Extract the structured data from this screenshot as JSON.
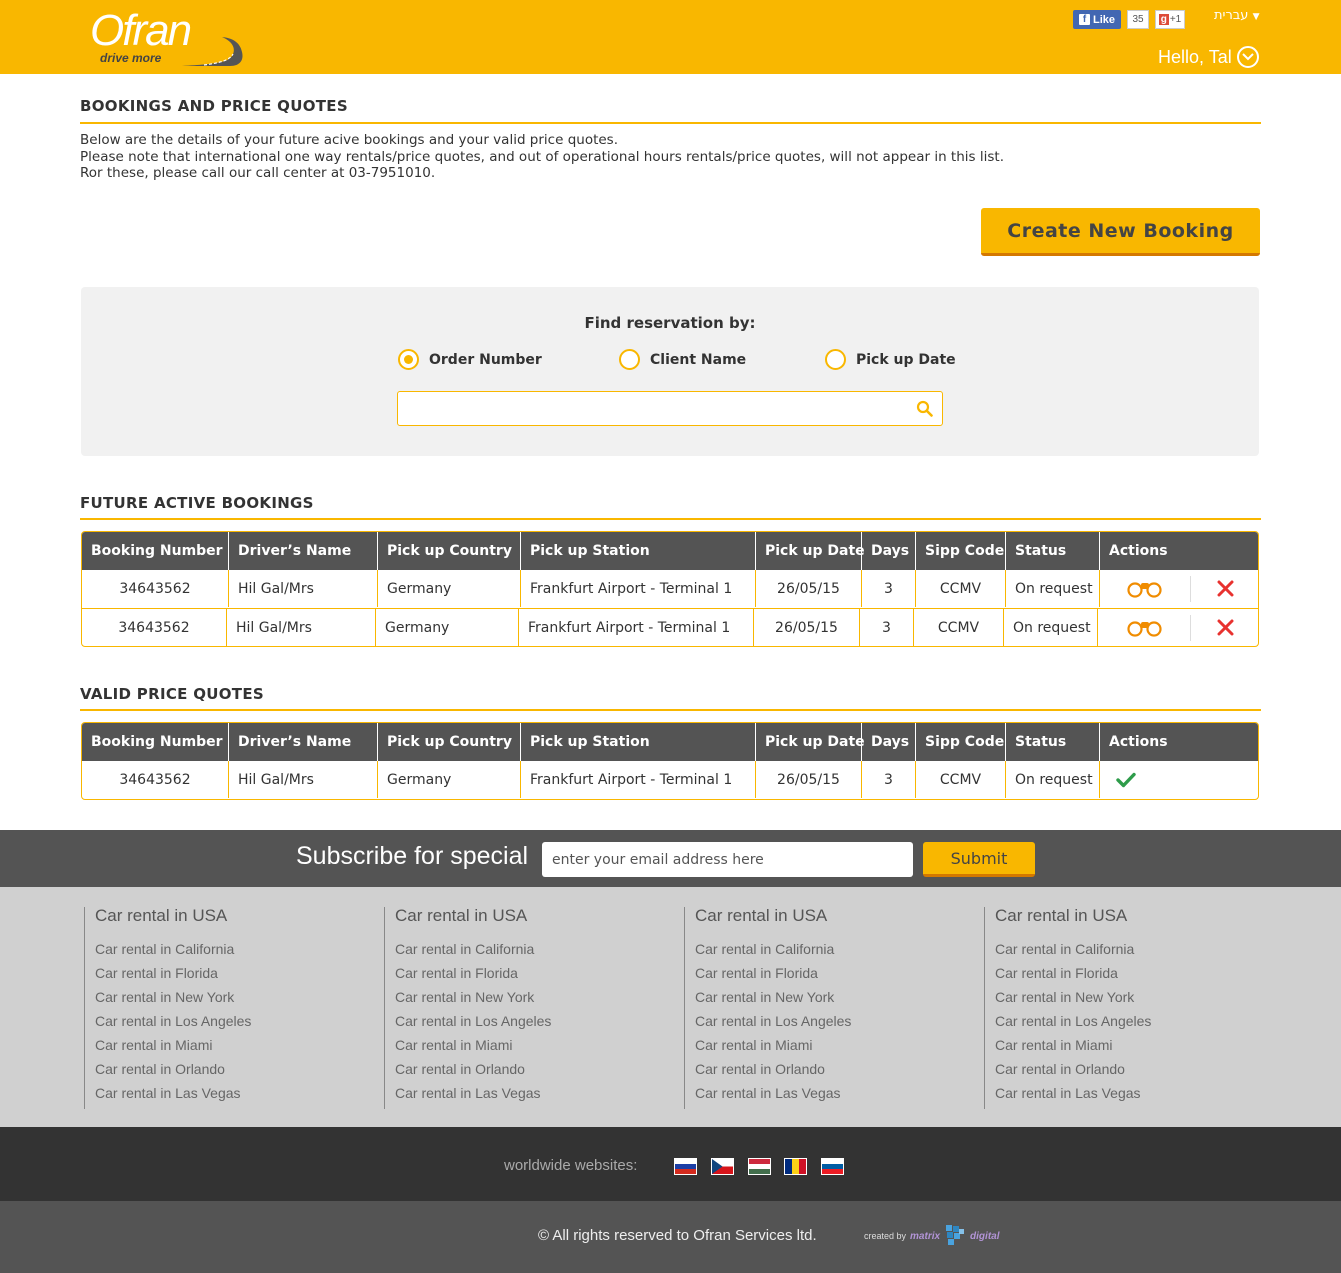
{
  "header": {
    "logo_text": "Ofran",
    "logo_tagline": "drive more",
    "fb_like": "Like",
    "fb_count": "35",
    "gplus_label": "+1",
    "language": "עברית",
    "greeting": "Hello, Tal",
    "brand_color": "#f9b700"
  },
  "intro": {
    "title": "BOOKINGS AND PRICE QUOTES",
    "lines": [
      "Below are the details of your future acive bookings and your valid price quotes.",
      "Please note that international one way rentals/price quotes, and out of operational hours rentals/price quotes, will not appear in this list.",
      "Ror these, please call our call center at 03-7951010."
    ],
    "create_button": "Create New Booking"
  },
  "find": {
    "label": "Find reservation by:",
    "options": [
      "Order Number",
      "Client Name",
      "Pick up Date"
    ],
    "selected": "Order Number",
    "search_value": ""
  },
  "columns": [
    "Booking Number",
    "Driver’s Name",
    "Pick up Country",
    "Pick up Station",
    "Pick up Date",
    "Days",
    "Sipp Code",
    "Status",
    "Actions"
  ],
  "future_bookings": {
    "title": "FUTURE ACTIVE BOOKINGS",
    "rows": [
      {
        "booking": "34643562",
        "driver": "Hil Gal/Mrs",
        "country": "Germany",
        "station": "Frankfurt Airport - Terminal 1",
        "date": "26/05/15",
        "days": "3",
        "sipp": "CCMV",
        "status": "On request",
        "actions": [
          "view-icon",
          "cancel-icon"
        ]
      },
      {
        "booking": "34643562",
        "driver": "Hil Gal/Mrs",
        "country": "Germany",
        "station": "Frankfurt Airport - Terminal 1",
        "date": "26/05/15",
        "days": "3",
        "sipp": "CCMV",
        "status": "On request",
        "actions": [
          "view-icon",
          "cancel-icon"
        ]
      }
    ]
  },
  "price_quotes": {
    "title": "VALID PRICE QUOTES",
    "rows": [
      {
        "booking": "34643562",
        "driver": "Hil Gal/Mrs",
        "country": "Germany",
        "station": "Frankfurt Airport - Terminal 1",
        "date": "26/05/15",
        "days": "3",
        "sipp": "CCMV",
        "status": "On request",
        "actions": [
          "check-icon"
        ]
      }
    ]
  },
  "subscribe": {
    "title": "Subscribe for special",
    "placeholder": "enter your email address here",
    "button": "Submit"
  },
  "footer_links": [
    {
      "heading": "Car rental in USA",
      "links": [
        "Car rental in California",
        "Car rental in Florida",
        "Car rental in New York",
        "Car rental in Los Angeles",
        "Car rental in Miami",
        "Car rental in Orlando",
        "Car rental in Las Vegas"
      ]
    },
    {
      "heading": "Car rental in USA",
      "links": [
        "Car rental in California",
        "Car rental in Florida",
        "Car rental in New York",
        "Car rental in Los Angeles",
        "Car rental in Miami",
        "Car rental in Orlando",
        "Car rental in Las Vegas"
      ]
    },
    {
      "heading": "Car rental in USA",
      "links": [
        "Car rental in California",
        "Car rental in Florida",
        "Car rental in New York",
        "Car rental in Los Angeles",
        "Car rental in Miami",
        "Car rental in Orlando",
        "Car rental in Las Vegas"
      ]
    },
    {
      "heading": "Car rental in USA",
      "links": [
        "Car rental in California",
        "Car rental in Florida",
        "Car rental in New York",
        "Car rental in Los Angeles",
        "Car rental in Miami",
        "Car rental in Orlando",
        "Car rental in Las Vegas"
      ]
    }
  ],
  "worldwide": {
    "label": "worldwide websites:",
    "flags": [
      "russia-flag",
      "czech-flag",
      "hungary-flag",
      "romania-flag",
      "slovenia-flag"
    ]
  },
  "copyright": {
    "text": "© All rights reserved to Ofran Services ltd.",
    "created_by": "created by",
    "agency_a": "matrix",
    "agency_b": "digital"
  }
}
